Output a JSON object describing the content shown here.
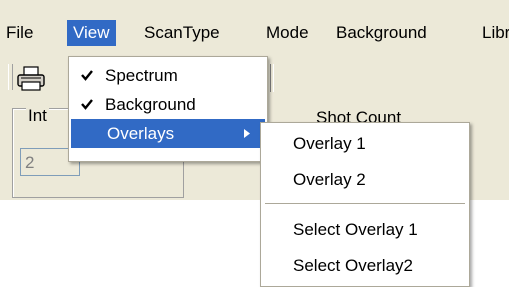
{
  "menubar": {
    "items": [
      {
        "label": "File"
      },
      {
        "label": "View"
      },
      {
        "label": "ScanType"
      },
      {
        "label": "Mode"
      },
      {
        "label": "Background"
      },
      {
        "label": "Libr"
      }
    ],
    "active_index": 1
  },
  "panel": {
    "group_label": "Int",
    "field_value": "2",
    "shot_label": "Shot Count"
  },
  "view_menu": {
    "items": [
      {
        "label": "Spectrum",
        "checked": true
      },
      {
        "label": "Background",
        "checked": true
      },
      {
        "label": "Overlays",
        "checked": false,
        "has_submenu": true
      }
    ],
    "highlight_index": 2
  },
  "overlays_menu": {
    "items": [
      {
        "label": "Overlay 1"
      },
      {
        "label": "Overlay 2"
      },
      {
        "label": "Select Overlay 1"
      },
      {
        "label": "Select Overlay2"
      }
    ]
  },
  "colors": {
    "window_bg": "#ece9d8",
    "highlight": "#316ac5",
    "menu_bg": "#ffffff"
  },
  "icons": [
    "print-icon",
    "check-icon",
    "submenu-arrow-icon"
  ]
}
